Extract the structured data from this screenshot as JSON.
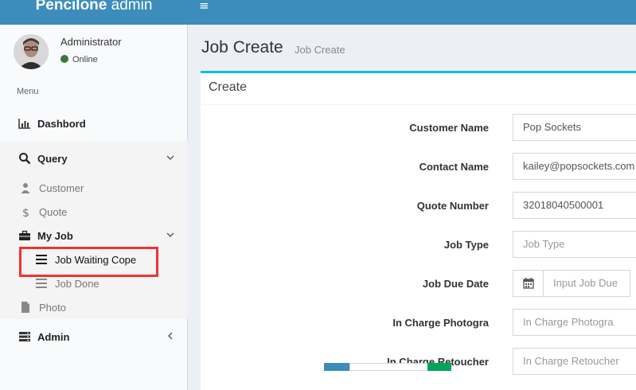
{
  "header": {
    "logo_bold": "Pencilone",
    "logo_rest": " admin",
    "menu_toggle": "≡"
  },
  "user": {
    "name": "Administrator",
    "status": "Online"
  },
  "sidebar": {
    "menu_header": "Menu",
    "dashboard": "Dashbord",
    "query": "Query",
    "customer": "Customer",
    "quote": "Quote",
    "my_job": "My Job",
    "job_waiting": "Job Waiting Cope",
    "job_done": "Job Done",
    "photo": "Photo",
    "admin": "Admin"
  },
  "page": {
    "title": "Job Create",
    "subtitle": "Job Create",
    "box_title": "Create"
  },
  "form": {
    "customer_name_label": "Customer Name",
    "customer_name_value": "Pop Sockets",
    "contact_name_label": "Contact Name",
    "contact_name_value": "kailey@popsockets.com",
    "quote_number_label": "Quote Number",
    "quote_number_value": "32018040500001",
    "job_type_label": "Job Type",
    "job_type_placeholder": "Job Type",
    "job_due_date_label": "Job Due Date",
    "job_due_date_placeholder": "Input Job Due",
    "in_charge_photographer_label": "In Charge Photogra",
    "in_charge_photographer_placeholder": "In Charge Photogra",
    "in_charge_retoucher_label": "In Charge Retoucher",
    "in_charge_retoucher_placeholder": "In Charge Retoucher"
  },
  "colors": {
    "topbar": "#3c8dbc",
    "box_accent": "#00c0ef",
    "highlight": "#f2312f",
    "online": "#3c763d"
  }
}
